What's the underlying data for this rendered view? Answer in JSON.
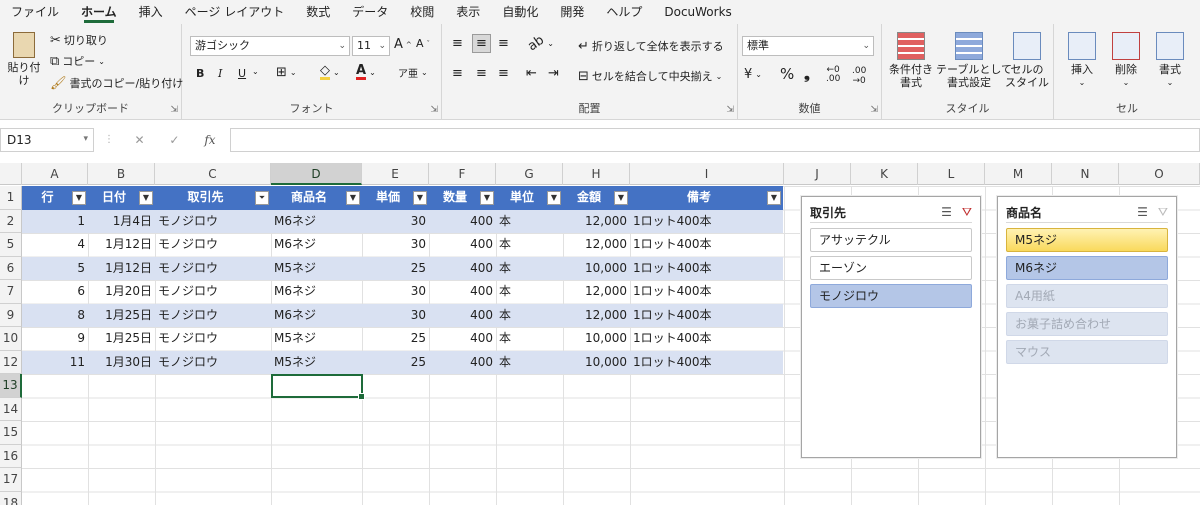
{
  "menu": [
    "ファイル",
    "ホーム",
    "挿入",
    "ページ レイアウト",
    "数式",
    "データ",
    "校閲",
    "表示",
    "自動化",
    "開発",
    "ヘルプ",
    "DocuWorks"
  ],
  "ribbon": {
    "clipboard": {
      "paste": "貼り付け",
      "cut": "切り取り",
      "copy": "コピー",
      "format_painter": "書式のコピー/貼り付け",
      "label": "クリップボード"
    },
    "font": {
      "name": "游ゴシック",
      "size": "11",
      "label": "フォント",
      "bold": "B",
      "italic": "I",
      "underline": "U"
    },
    "alignment": {
      "wrap": "折り返して全体を表示する",
      "merge": "セルを結合して中央揃え",
      "label": "配置"
    },
    "number": {
      "format": "標準",
      "percent": "%",
      "comma": "❟",
      "label": "数値"
    },
    "styles": {
      "conditional": "条件付き\n書式",
      "table": "テーブルとして\n書式設定",
      "cell": "セルの\nスタイル",
      "label": "スタイル"
    },
    "cells": {
      "insert": "挿入",
      "delete": "削除",
      "format": "書式",
      "label": "セル"
    }
  },
  "formula_bar": {
    "name_box": "D13",
    "formula": ""
  },
  "columns": [
    "A",
    "B",
    "C",
    "D",
    "E",
    "F",
    "G",
    "H",
    "I",
    "J",
    "K",
    "L",
    "M",
    "N",
    "O"
  ],
  "selected_column": "D",
  "row_numbers": [
    "1",
    "2",
    "5",
    "6",
    "7",
    "9",
    "10",
    "12",
    "13",
    "14",
    "15",
    "16",
    "17",
    "18"
  ],
  "selected_row": "13",
  "table": {
    "headers": [
      "行",
      "日付",
      "取引先",
      "商品名",
      "単価",
      "数量",
      "単位",
      "金額",
      "備考"
    ],
    "rows": [
      [
        "1",
        "1月4日",
        "モノジロウ",
        "M6ネジ",
        "30",
        "400",
        "本",
        "12,000",
        "1ロット400本"
      ],
      [
        "4",
        "1月12日",
        "モノジロウ",
        "M6ネジ",
        "30",
        "400",
        "本",
        "12,000",
        "1ロット400本"
      ],
      [
        "5",
        "1月12日",
        "モノジロウ",
        "M5ネジ",
        "25",
        "400",
        "本",
        "10,000",
        "1ロット400本"
      ],
      [
        "6",
        "1月20日",
        "モノジロウ",
        "M6ネジ",
        "30",
        "400",
        "本",
        "12,000",
        "1ロット400本"
      ],
      [
        "8",
        "1月25日",
        "モノジロウ",
        "M6ネジ",
        "30",
        "400",
        "本",
        "12,000",
        "1ロット400本"
      ],
      [
        "9",
        "1月25日",
        "モノジロウ",
        "M5ネジ",
        "25",
        "400",
        "本",
        "10,000",
        "1ロット400本"
      ],
      [
        "11",
        "1月30日",
        "モノジロウ",
        "M5ネジ",
        "25",
        "400",
        "本",
        "10,000",
        "1ロット400本"
      ]
    ]
  },
  "slicers": [
    {
      "title": "取引先",
      "items": [
        {
          "label": "アサッテクル",
          "state": "normal"
        },
        {
          "label": "エーゾン",
          "state": "normal"
        },
        {
          "label": "モノジロウ",
          "state": "selected"
        }
      ]
    },
    {
      "title": "商品名",
      "items": [
        {
          "label": "M5ネジ",
          "state": "hover"
        },
        {
          "label": "M6ネジ",
          "state": "selected"
        },
        {
          "label": "A4用紙",
          "state": "nodata"
        },
        {
          "label": "お菓子詰め合わせ",
          "state": "nodata"
        },
        {
          "label": "マウス",
          "state": "nodata"
        }
      ]
    }
  ],
  "colors": {
    "accent": "#1e6b3a",
    "table_header": "#4472c4",
    "band": "#d9e1f2",
    "slicer_selected": "#b4c6e7"
  }
}
